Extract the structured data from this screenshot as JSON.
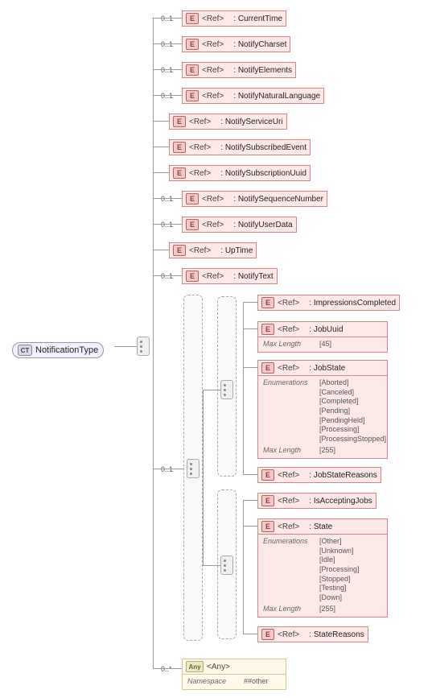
{
  "root": {
    "badge": "CT",
    "name": "NotificationType"
  },
  "occ": {
    "zero_one": "0..1",
    "zero_many": "0..*"
  },
  "ref_tag": "<Ref>",
  "any_tag": "<Any>",
  "any_badge": "Any",
  "nodes": {
    "current_time": "CurrentTime",
    "notify_charset": "NotifyCharset",
    "notify_elements": "NotifyElements",
    "notify_natural_language": "NotifyNaturalLanguage",
    "notify_service_uri": "NotifyServiceUri",
    "notify_subscribed_event": "NotifySubscribedEvent",
    "notify_subscription_uuid": "NotifySubscriptionUuid",
    "notify_sequence_number": "NotifySequenceNumber",
    "notify_user_data": "NotifyUserData",
    "up_time": "UpTime",
    "notify_text": "NotifyText",
    "impressions_completed": "ImpressionsCompleted",
    "job_uuid": "JobUuid",
    "job_state": "JobState",
    "job_state_reasons": "JobStateReasons",
    "is_accepting_jobs": "IsAcceptingJobs",
    "state": "State",
    "state_reasons": "StateReasons"
  },
  "facets": {
    "max_length_label": "Max Length",
    "enumerations_label": "Enumerations",
    "job_uuid_maxlen": "[45]",
    "job_state_enums": [
      "[Aborted]",
      "[Canceled]",
      "[Completed]",
      "[Pending]",
      "[PendingHeld]",
      "[Processing]",
      "[ProcessingStopped]"
    ],
    "job_state_maxlen": "[255]",
    "state_enums": [
      "[Other]",
      "[Unknown]",
      "[Idle]",
      "[Processing]",
      "[Stopped]",
      "[Testing]",
      "[Down]"
    ],
    "state_maxlen": "[255]"
  },
  "any_block": {
    "namespace_label": "Namespace",
    "namespace_value": "##other"
  }
}
